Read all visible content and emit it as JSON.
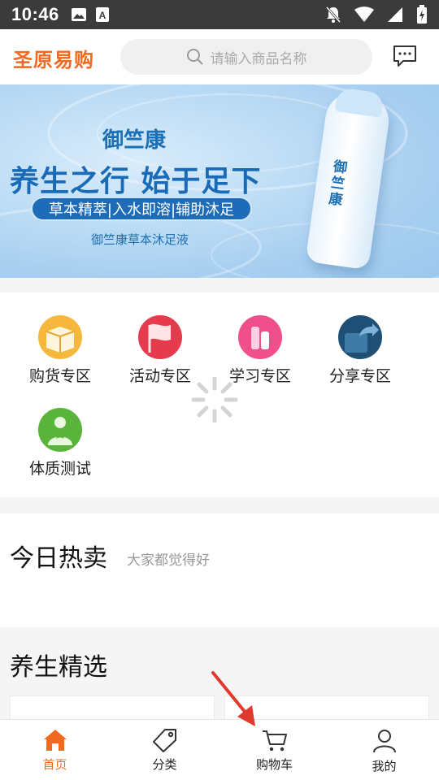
{
  "status_bar": {
    "time": "10:46"
  },
  "header": {
    "logo_text": "圣原易购",
    "search_placeholder": "请输入商品名称"
  },
  "banner": {
    "brand": "御竺康",
    "slogan": "养生之行  始于足下",
    "features": "草本精萃|入水即溶|辅助沐足",
    "product_name": "御竺康草本沐足液",
    "bottle_label": "御竺康"
  },
  "categories": [
    {
      "label": "购货专区",
      "icon": "box-icon",
      "color": "#f6b83c"
    },
    {
      "label": "活动专区",
      "icon": "flag-icon",
      "color": "#e63b4c"
    },
    {
      "label": "学习专区",
      "icon": "study-icon",
      "color": "#ef4f8a"
    },
    {
      "label": "分享专区",
      "icon": "share-icon",
      "color": "#1f4f74"
    },
    {
      "label": "体质测试",
      "icon": "health-test-icon",
      "color": "#5ab33a"
    }
  ],
  "hot_section": {
    "title": "今日热卖",
    "subtitle": "大家都觉得好"
  },
  "health_section": {
    "title": "养生精选"
  },
  "bottom_nav": [
    {
      "label": "首页",
      "icon": "home-icon",
      "active": true
    },
    {
      "label": "分类",
      "icon": "tag-icon",
      "active": false
    },
    {
      "label": "购物车",
      "icon": "cart-icon",
      "active": false
    },
    {
      "label": "我的",
      "icon": "profile-icon",
      "active": false
    }
  ],
  "colors": {
    "accent": "#f26a21",
    "banner_blue": "#1b6fb5",
    "arrow": "#e03a2f"
  }
}
